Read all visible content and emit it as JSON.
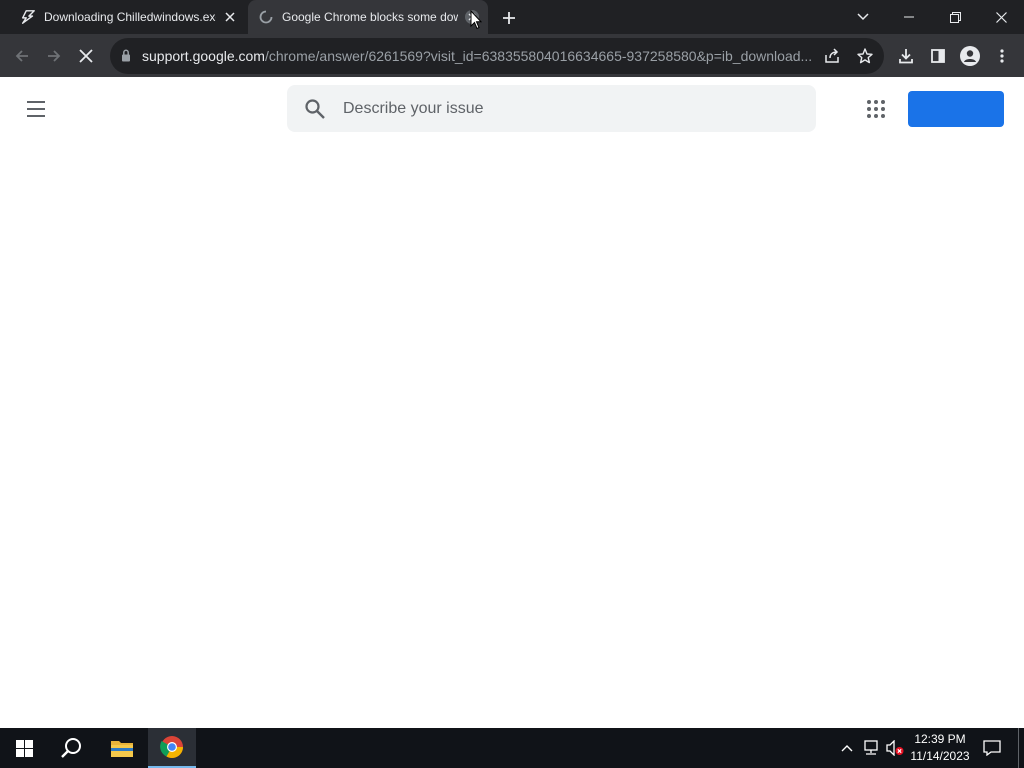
{
  "browser": {
    "tabs": [
      {
        "title": "Downloading Chilledwindows.exe",
        "active": false,
        "favicon": "bolt-icon"
      },
      {
        "title": "Google Chrome blocks some downloads",
        "active": true,
        "favicon": "loading-icon"
      }
    ],
    "address": {
      "domain": "support.google.com",
      "path": "/chrome/answer/6261569?visit_id=638355804016634665-937258580&p=ib_download..."
    }
  },
  "page": {
    "search": {
      "placeholder": "Describe your issue"
    },
    "signin_label": ""
  },
  "taskbar": {
    "time": "12:39 PM",
    "date": "11/14/2023"
  },
  "colors": {
    "tabstrip": "#202124",
    "toolbar": "#35363a",
    "accent": "#1a73e8",
    "taskbar": "#101318"
  }
}
